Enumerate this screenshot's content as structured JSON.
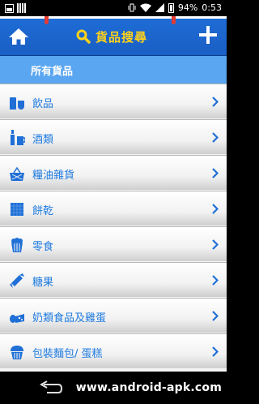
{
  "status_bar": {
    "battery": "94%",
    "time": "0:53"
  },
  "header": {
    "title": "貨品搜尋"
  },
  "all_goods": {
    "label": "所有貨品"
  },
  "categories": [
    {
      "label": "飲品",
      "icon": "drink-icon"
    },
    {
      "label": "酒類",
      "icon": "alcohol-icon"
    },
    {
      "label": "糧油雜貨",
      "icon": "basket-icon"
    },
    {
      "label": "餅乾",
      "icon": "biscuit-icon"
    },
    {
      "label": "零食",
      "icon": "popcorn-icon"
    },
    {
      "label": "糖果",
      "icon": "candy-icon"
    },
    {
      "label": "奶類食品及雞蛋",
      "icon": "dairy-icon"
    },
    {
      "label": "包裝麵包/ 蛋糕",
      "icon": "cake-icon"
    }
  ],
  "watermark": "www.android-apk.com",
  "colors": {
    "header_blue": "#1a5fc4",
    "title_yellow": "#ffd21a",
    "accent_blue": "#1f7be0",
    "all_goods_bar": "#5aa6f0"
  }
}
